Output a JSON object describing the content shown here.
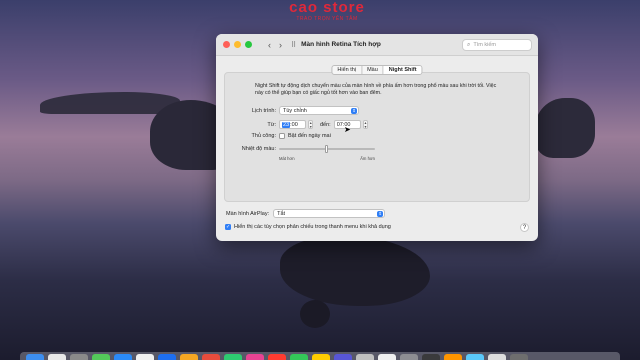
{
  "watermark": {
    "brand": "cao store",
    "tagline": "TRAO TRỌN YÊN TÂM"
  },
  "window": {
    "title": "Màn hình Retina Tích hợp",
    "search_placeholder": "Tìm kiếm",
    "nav_back": "‹",
    "nav_forward": "›",
    "grid": "⠿"
  },
  "tabs": [
    {
      "label": "Hiển thị",
      "active": false
    },
    {
      "label": "Màu",
      "active": false
    },
    {
      "label": "Night Shift",
      "active": true
    }
  ],
  "night_shift": {
    "description": "Night Shift tự động dịch chuyển màu của màn hình về phía ấm hơn trong phổ màu sau khi trời tối. Việc này có thể giúp bạn có giấc ngủ tốt hơn vào ban đêm.",
    "schedule_label": "Lịch trình:",
    "schedule_value": "Tùy chỉnh",
    "from_label": "Từ:",
    "from_hour": "23",
    "from_rest": ":00",
    "to_label": "đến:",
    "to_value": "07:00",
    "manual_label": "Thủ công:",
    "manual_checkbox_label": "Bật đến ngày mai",
    "manual_checked": false,
    "temperature_label": "Nhiệt độ màu:",
    "temperature_min_label": "Mát hơn",
    "temperature_max_label": "Ấm hơn",
    "temperature_level": 0.5
  },
  "airplay": {
    "label": "Màn hình AirPlay:",
    "value": "Tắt"
  },
  "mirroring": {
    "label": "Hiển thị các tùy chọn phản chiếu trong thanh menu khi khả dụng",
    "checked": true
  },
  "help_label": "?",
  "colors": {
    "accent": "#2f7ef6",
    "close": "#fe5f57",
    "minimize": "#febc2e",
    "zoom": "#28c840",
    "brand": "#e0283a"
  },
  "dock_apps": [
    "#3d8ef0",
    "#e9e9e9",
    "#8a8a8a",
    "#53c85a",
    "#2b8af7",
    "#f0f0f0",
    "#1d6ef0",
    "#f5a623",
    "#e74c3c",
    "#2ecc71",
    "#e84393",
    "#ff3b30",
    "#34c759",
    "#ffcc00",
    "#5856d6",
    "#c0c0c0",
    "#f0f0f0",
    "#8e8e93",
    "#3a3a3c",
    "#ff9500",
    "#5ac8fa",
    "#dedede",
    "#6e6e6e"
  ]
}
